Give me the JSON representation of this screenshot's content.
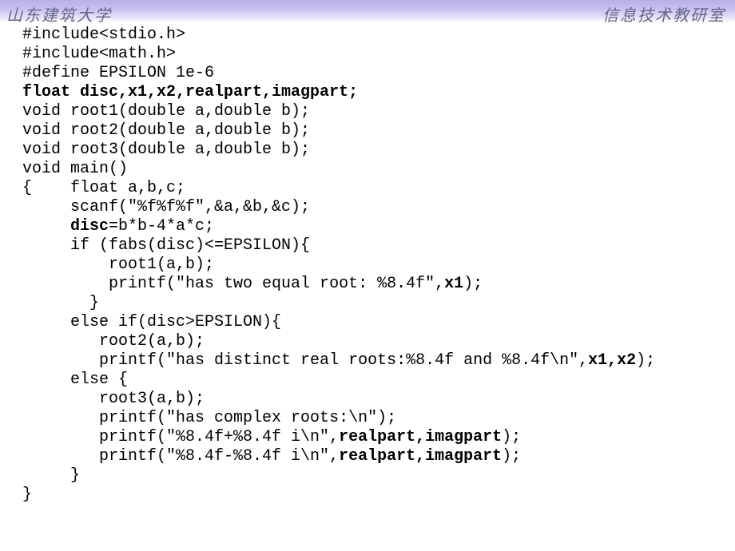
{
  "header": {
    "left": "山东建筑大学",
    "right": "信息技术教研室"
  },
  "code": {
    "line01": "#include<stdio.h>",
    "line02": "#include<math.h>",
    "line03": "#define EPSILON 1e-6",
    "line04": "float disc,x1,x2,realpart,imagpart;",
    "line05": "void root1(double a,double b);",
    "line06": "void root2(double a,double b);",
    "line07": "void root3(double a,double b);",
    "line08": "void main()",
    "line09": "{    float a,b,c;",
    "line10": "     scanf(\"%f%f%f\",&a,&b,&c);",
    "line11a": "     ",
    "line11b": "disc",
    "line11c": "=b*b-4*a*c;",
    "line12": "     if (fabs(disc)<=EPSILON){",
    "line13": "         root1(a,b);",
    "line14a": "         printf(\"has two equal root: %8.4f\",",
    "line14b": "x1",
    "line14c": ");",
    "line15": "       }",
    "line16": "     else if(disc>EPSILON){",
    "line17": "        root2(a,b);",
    "line18a": "        printf(\"has distinct real roots:%8.4f and %8.4f\\n\",",
    "line18b": "x1,x2",
    "line18c": ");",
    "line19": "     else {",
    "line20": "        root3(a,b);",
    "line21": "        printf(\"has complex roots:\\n\");",
    "line22a": "        printf(\"%8.4f+%8.4f i\\n\",",
    "line22b": "realpart,imagpart",
    "line22c": ");",
    "line23a": "        printf(\"%8.4f-%8.4f i\\n\",",
    "line23b": "realpart,imagpart",
    "line23c": ");",
    "line24": "     }",
    "line25": "}"
  }
}
